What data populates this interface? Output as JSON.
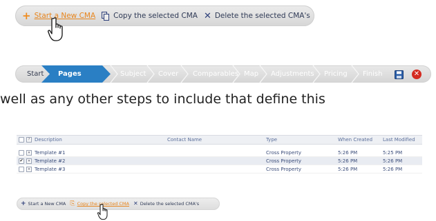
{
  "toolbar": {
    "new_label": "Start a New CMA",
    "copy_label": "Copy the selected CMA",
    "delete_label": "Delete the selected CMA's"
  },
  "wizard": {
    "steps": [
      "Start",
      "Pages",
      "Subject",
      "Cover",
      "Comparables",
      "Map",
      "Adjustments",
      "Pricing",
      "Finish"
    ],
    "active_step": "Pages"
  },
  "sentence": "well as any other steps to include that define this",
  "table": {
    "columns": [
      "Description",
      "Contact Name",
      "Type",
      "When Created",
      "Last Modified"
    ],
    "rows": [
      {
        "description": "Template #1",
        "contact": "",
        "type": "Cross Property",
        "created": "5:26 PM",
        "modified": "5:25 PM",
        "checked": false
      },
      {
        "description": "Template #2",
        "contact": "",
        "type": "Cross Property",
        "created": "5:26 PM",
        "modified": "5:26 PM",
        "checked": true
      },
      {
        "description": "Template #3",
        "contact": "",
        "type": "Cross Property",
        "created": "5:26 PM",
        "modified": "5:26 PM",
        "checked": false
      }
    ]
  },
  "toolbar2": {
    "new_label": "Start a New CMA",
    "copy_label": "Copy the selected CMA",
    "delete_label": "Delete the selected CMA's"
  },
  "colors": {
    "accent_orange": "#e8851c",
    "active_step_blue": "#2a7fc4",
    "navy": "#2d3f7a",
    "close_red": "#d42a20"
  }
}
